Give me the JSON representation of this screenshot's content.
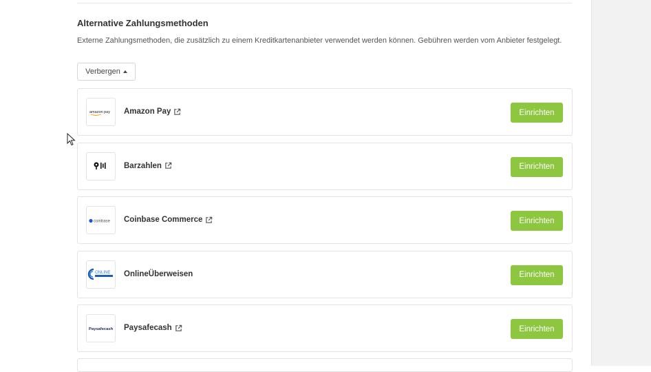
{
  "section": {
    "title": "Alternative Zahlungsmethoden",
    "description": "Externe Zahlungsmethoden, die zusätzlich zu einem Kreditkartenanbieter verwendet werden können. Gebühren werden vom Anbieter festgelegt.",
    "toggle_label": "Verbergen"
  },
  "providers": [
    {
      "name": "Amazon Pay",
      "external_link": true,
      "button_label": "Einrichten",
      "logo_text": "amazon pay",
      "icon": "amazon-pay-logo"
    },
    {
      "name": "Barzahlen",
      "external_link": true,
      "button_label": "Einrichten",
      "logo_text": "",
      "icon": "barzahlen-logo"
    },
    {
      "name": "Coinbase Commerce",
      "external_link": true,
      "button_label": "Einrichten",
      "logo_text": "coinbase",
      "icon": "coinbase-logo"
    },
    {
      "name": "OnlineÜberweisen",
      "external_link": false,
      "button_label": "Einrichten",
      "logo_text": "ONLINE",
      "icon": "onlineueberweisen-logo"
    },
    {
      "name": "Paysafecash",
      "external_link": true,
      "button_label": "Einrichten",
      "logo_text": "Paysafecash",
      "icon": "paysafecash-logo"
    }
  ],
  "colors": {
    "primary_button": "#8dc63f",
    "border": "#e3e3e3",
    "side_panel": "#f2f2f2"
  }
}
